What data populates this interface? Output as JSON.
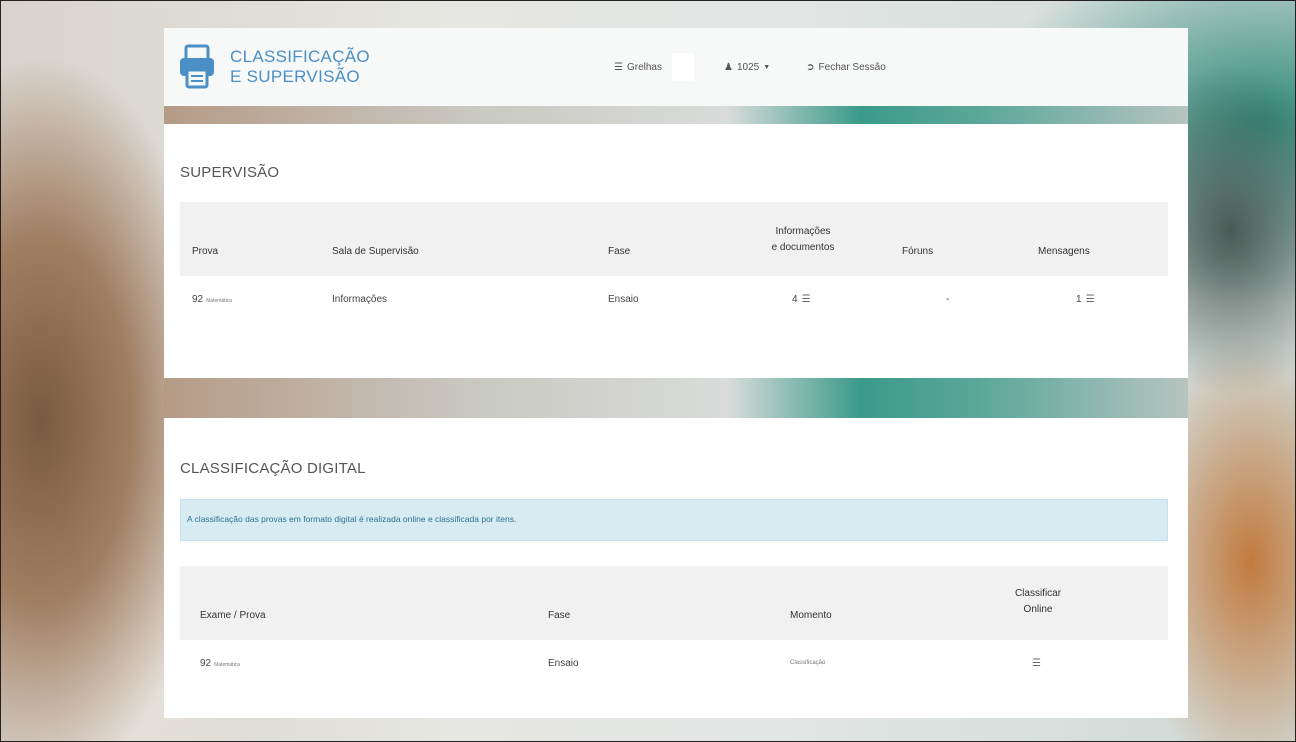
{
  "header": {
    "brand_line1": "CLASSIFICAÇÃO",
    "brand_line2": "E SUPERVISÃO",
    "nav": {
      "grelhas": {
        "icon": "list-icon",
        "label": "Grelhas"
      },
      "user": {
        "icon": "user-icon",
        "label": "1025"
      },
      "logout": {
        "icon": "logout-icon",
        "label": "Fechar Sessão"
      }
    }
  },
  "colors": {
    "brand": "#4a8fc6",
    "alert_bg": "#d7ecf2",
    "table_header_bg": "#f1f1f1"
  },
  "supervisao": {
    "title": "SUPERVISÃO",
    "columns": {
      "prova": "Prova",
      "sala": "Sala de Supervisão",
      "fase": "Fase",
      "info_line1": "Informações",
      "info_line2": "e documentos",
      "foruns": "Fóruns",
      "mensagens": "Mensagens"
    },
    "rows": [
      {
        "prova": "92",
        "prova_sub": "Matemática",
        "sala": "Informações",
        "fase": "Ensaio",
        "info": "4",
        "foruns": "-",
        "mensagens": "1"
      }
    ]
  },
  "classificacao": {
    "title": "CLASSIFICAÇÃO DIGITAL",
    "alert": "A classificação das provas em formato digital é realizada online e classificada por itens.",
    "columns": {
      "exame": "Exame / Prova",
      "fase": "Fase",
      "momento": "Momento",
      "online_line1": "Classificar",
      "online_line2": "Online"
    },
    "rows": [
      {
        "exame": "92",
        "exame_sub": "Matemática",
        "fase": "Ensaio",
        "momento": "Classificação"
      }
    ]
  }
}
